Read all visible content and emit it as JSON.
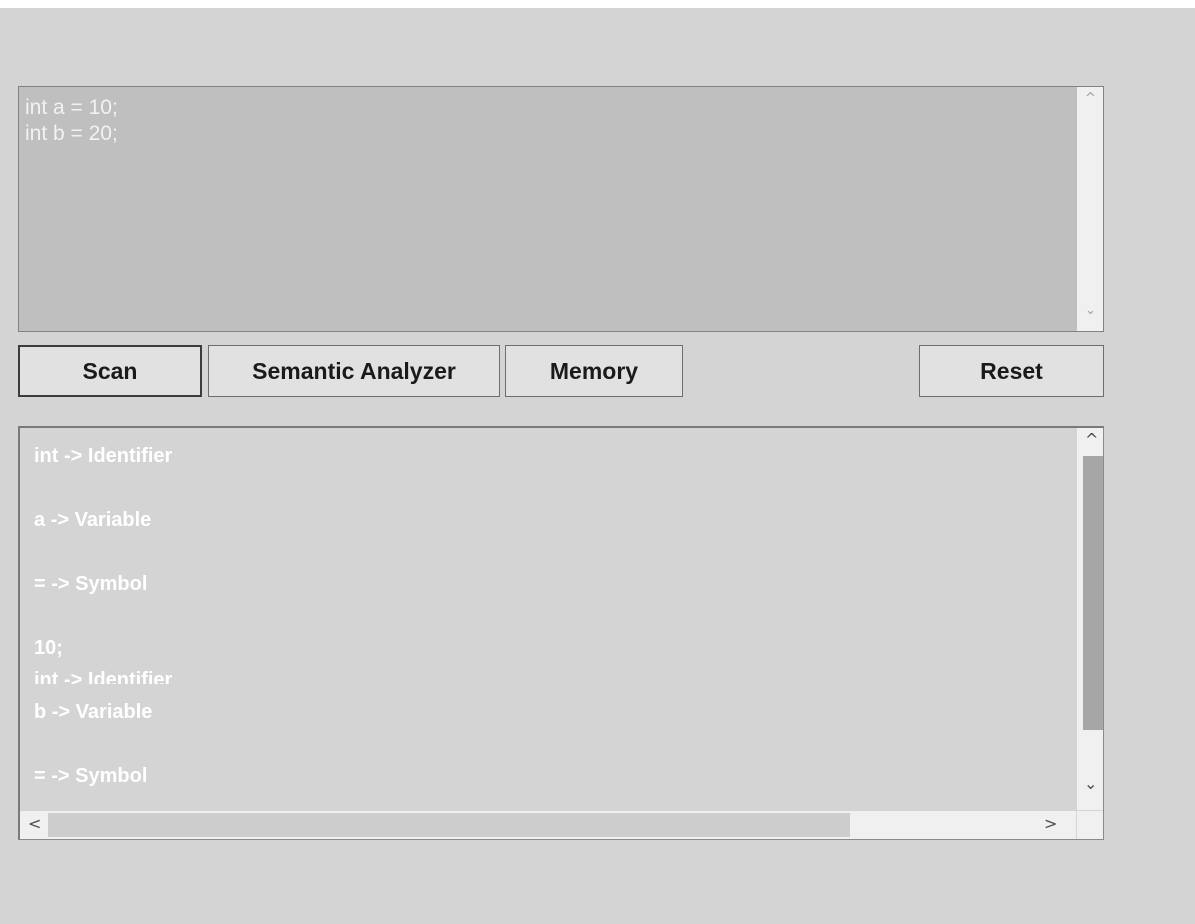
{
  "input": {
    "code": "int a = 10;\nint b = 20;"
  },
  "buttons": {
    "scan": "Scan",
    "semantic": "Semantic Analyzer",
    "memory": "Memory",
    "reset": "Reset"
  },
  "output": {
    "lines": [
      "int -> Identifier",
      "a -> Variable",
      "= -> Symbol",
      "10;",
      "int -> Identifier",
      "b -> Variable",
      "= -> Symbol"
    ]
  },
  "icons": {
    "up": "^",
    "down": "⌄",
    "left": "<",
    "right": ">"
  },
  "colors": {
    "window_bg": "#d4d4d4",
    "code_bg": "#bfbfbf",
    "text": "#ffffff"
  }
}
